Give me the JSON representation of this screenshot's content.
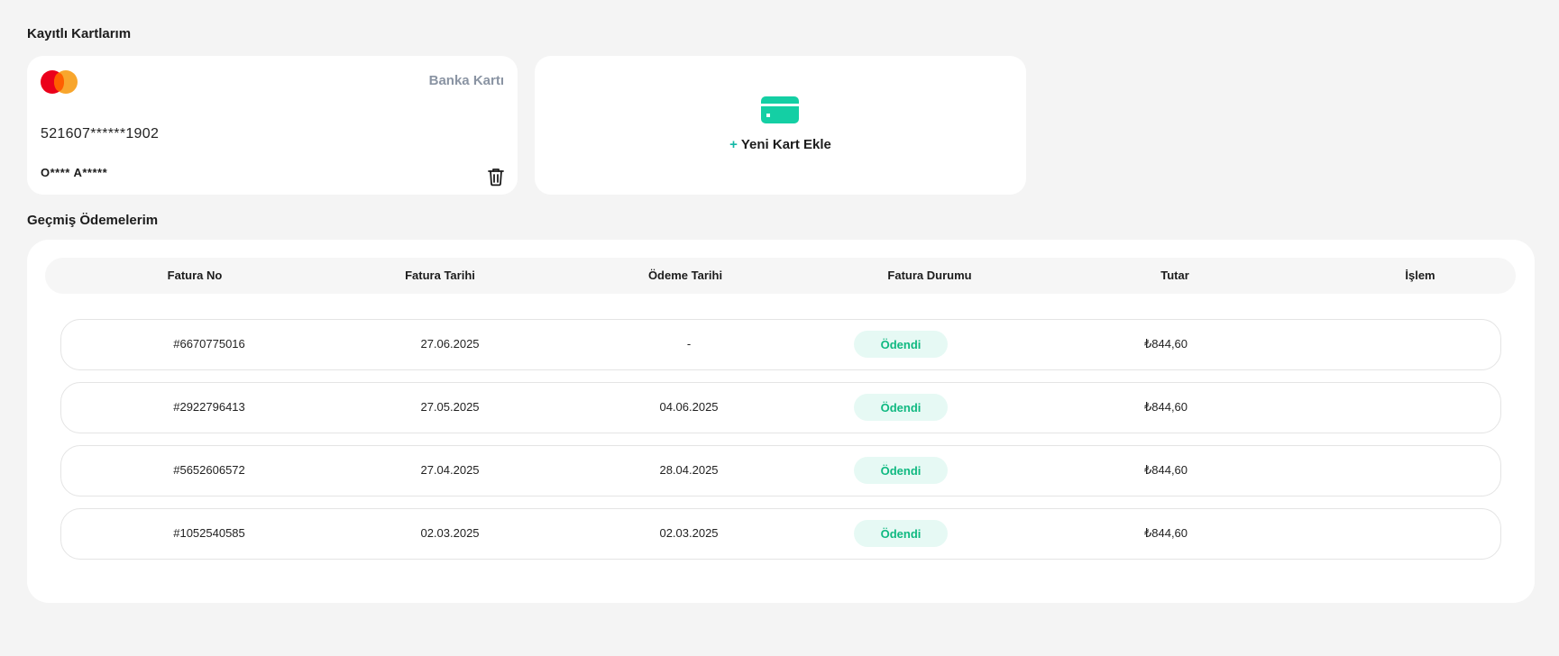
{
  "sections": {
    "saved_cards_title": "Kayıtlı Kartlarım",
    "payment_history_title": "Geçmiş Ödemelerim"
  },
  "saved_card": {
    "brand_icon": "mastercard-logo",
    "type": "Banka Kartı",
    "number": "521607******1902",
    "holder": "O**** A*****",
    "delete_icon": "trash-icon"
  },
  "add_card": {
    "icon": "credit-card-icon",
    "plus": "+",
    "label": "Yeni Kart Ekle",
    "accent_color": "#14cfa4"
  },
  "table": {
    "headers": [
      "Fatura No",
      "Fatura Tarihi",
      "Ödeme Tarihi",
      "Fatura Durumu",
      "Tutar",
      "İşlem"
    ],
    "rows": [
      {
        "invoice_no": "#6670775016",
        "invoice_date": "27.06.2025",
        "payment_date": "-",
        "status": "Ödendi",
        "amount": "₺844,60"
      },
      {
        "invoice_no": "#2922796413",
        "invoice_date": "27.05.2025",
        "payment_date": "04.06.2025",
        "status": "Ödendi",
        "amount": "₺844,60"
      },
      {
        "invoice_no": "#5652606572",
        "invoice_date": "27.04.2025",
        "payment_date": "28.04.2025",
        "status": "Ödendi",
        "amount": "₺844,60"
      },
      {
        "invoice_no": "#1052540585",
        "invoice_date": "02.03.2025",
        "payment_date": "02.03.2025",
        "status": "Ödendi",
        "amount": "₺844,60"
      }
    ]
  },
  "colors": {
    "status_paid_text": "#10b981",
    "status_paid_bg": "#e6f9f4",
    "page_bg": "#f4f4f4"
  }
}
